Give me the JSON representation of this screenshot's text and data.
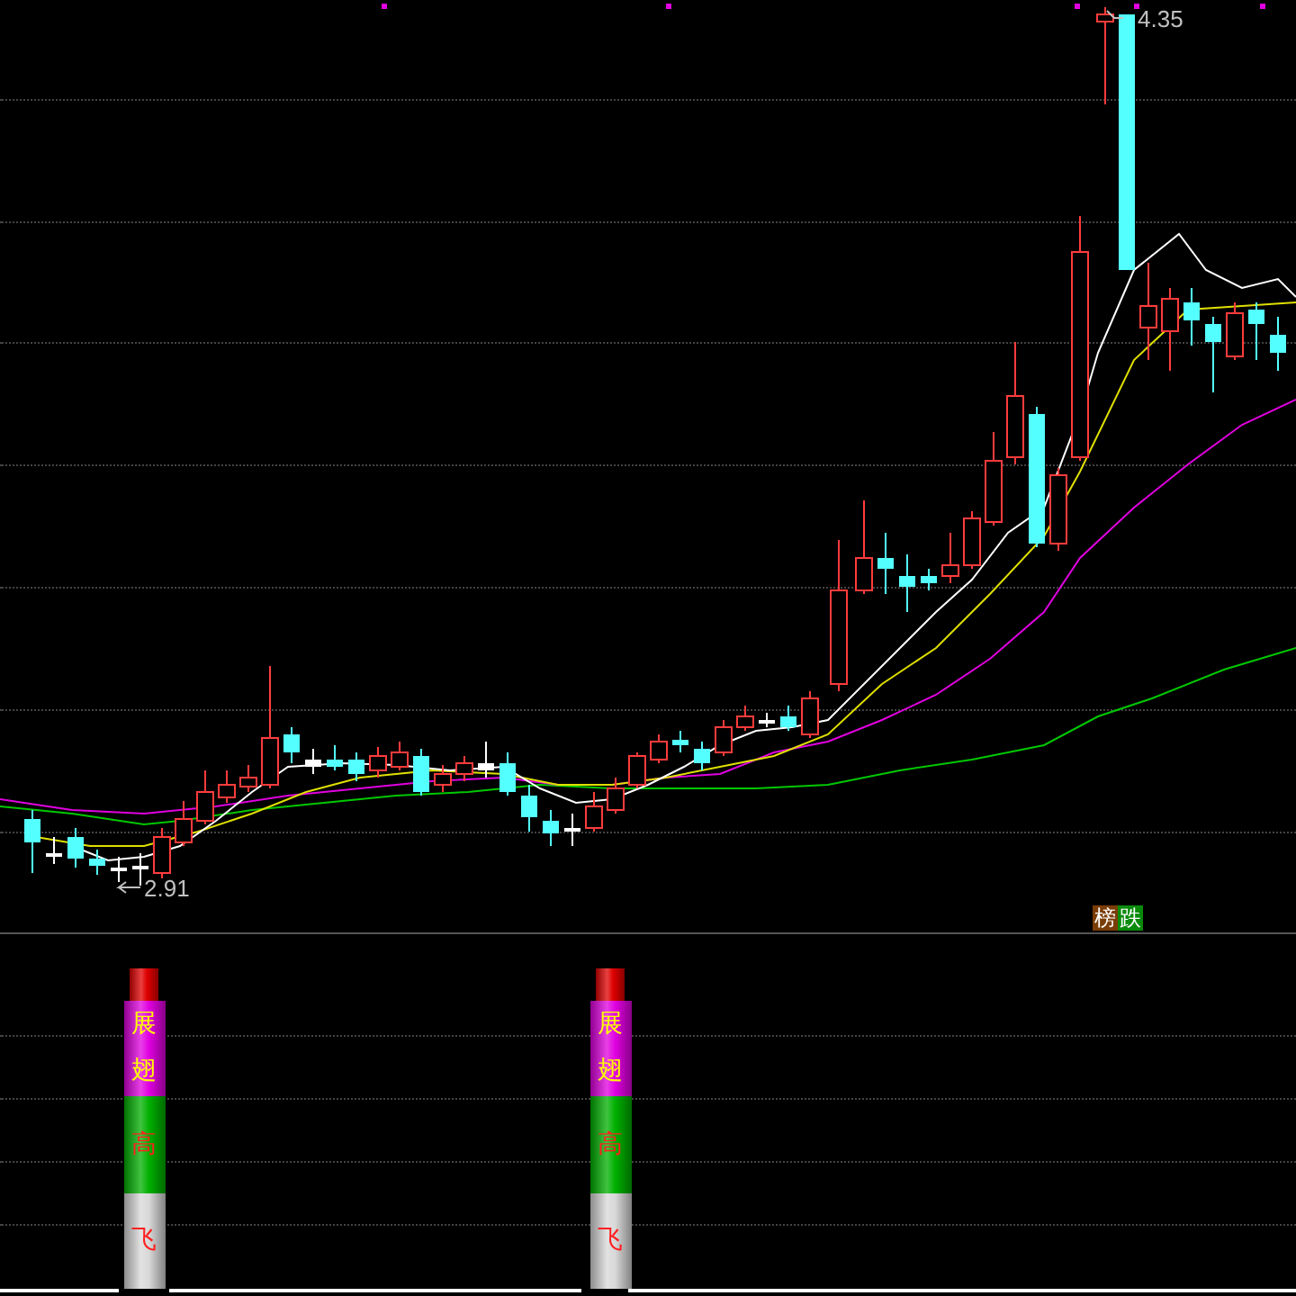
{
  "main_chart": {
    "high_label": "4.35",
    "low_label": "2.91",
    "signal_badges": [
      {
        "text": "榜",
        "color": "#7a3c06"
      },
      {
        "text": "跌",
        "color": "#0a8a0a"
      }
    ]
  },
  "indicator_columns": [
    {
      "segments": [
        {
          "color": "#e00000"
        },
        {
          "color": "#e000e0",
          "texts": [
            "展",
            "翅"
          ]
        },
        {
          "color": "#00b000",
          "texts": [
            "高"
          ]
        },
        {
          "color": "#d8d8d8",
          "texts": [
            "飞"
          ]
        }
      ]
    },
    {
      "segments": [
        {
          "color": "#e00000"
        },
        {
          "color": "#e000e0",
          "texts": [
            "展",
            "翅"
          ]
        },
        {
          "color": "#00b000",
          "texts": [
            "高"
          ]
        },
        {
          "color": "#d8d8d8",
          "texts": [
            "飞"
          ]
        }
      ]
    }
  ]
}
